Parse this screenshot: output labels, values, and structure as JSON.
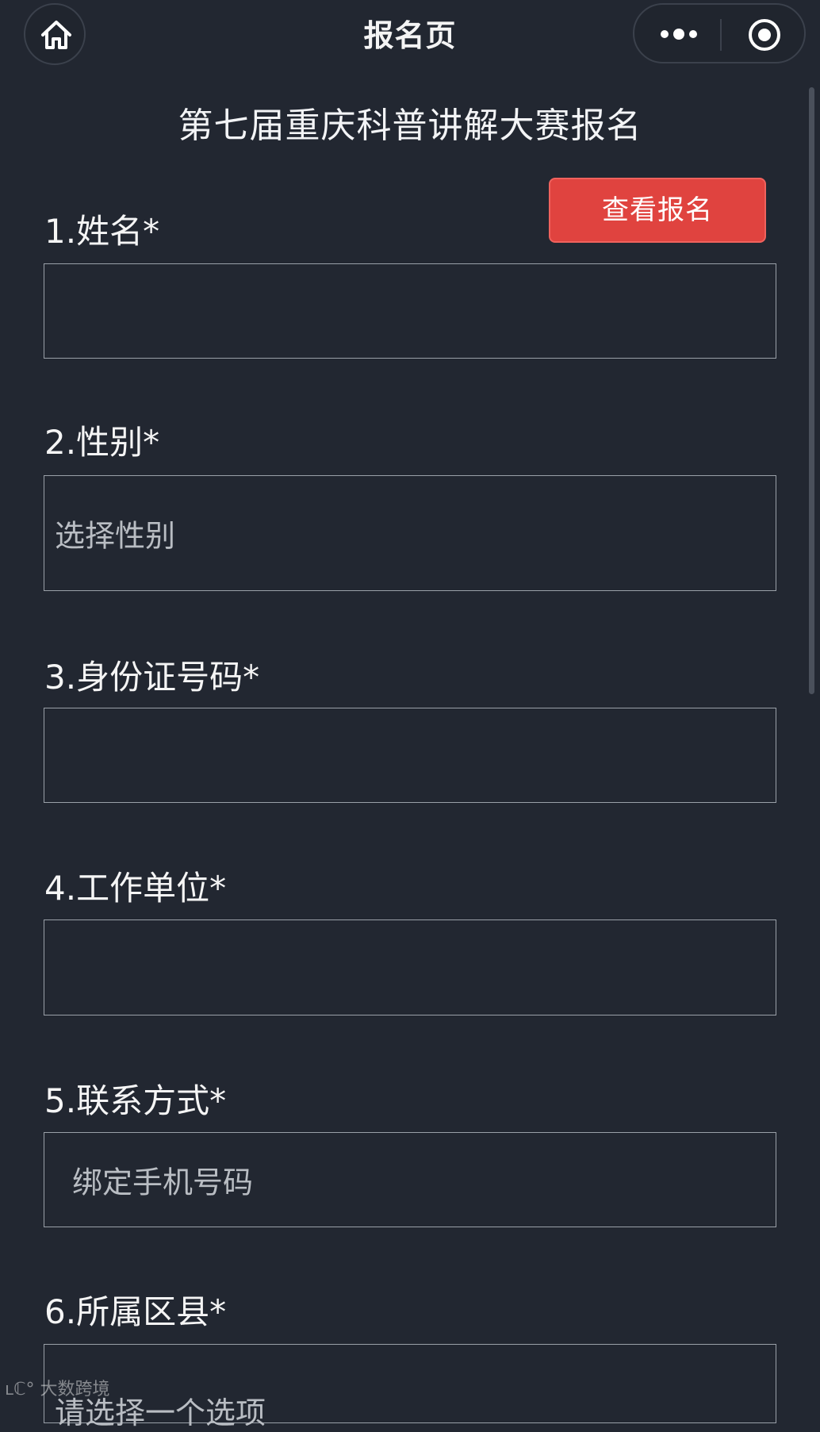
{
  "nav": {
    "title": "报名页"
  },
  "form": {
    "title": "第七届重庆科普讲解大赛报名",
    "view_button_label": "查看报名",
    "fields": [
      {
        "label": "1.姓名*",
        "placeholder": ""
      },
      {
        "label": "2.性别*",
        "placeholder": "选择性别"
      },
      {
        "label": "3.身份证号码*",
        "placeholder": ""
      },
      {
        "label": "4.工作单位*",
        "placeholder": ""
      },
      {
        "label": "5.联系方式*",
        "placeholder": "绑定手机号码"
      },
      {
        "label": "6.所属区县*",
        "placeholder": "请选择一个选项"
      }
    ]
  },
  "watermark": {
    "text": "大数跨境"
  },
  "icons": {
    "home": "home-icon",
    "more": "more-dots-icon",
    "close": "target-circle-icon"
  },
  "colors": {
    "background": "#222731",
    "accent_button": "#e0433f",
    "field_border": "#9aa0a8"
  }
}
